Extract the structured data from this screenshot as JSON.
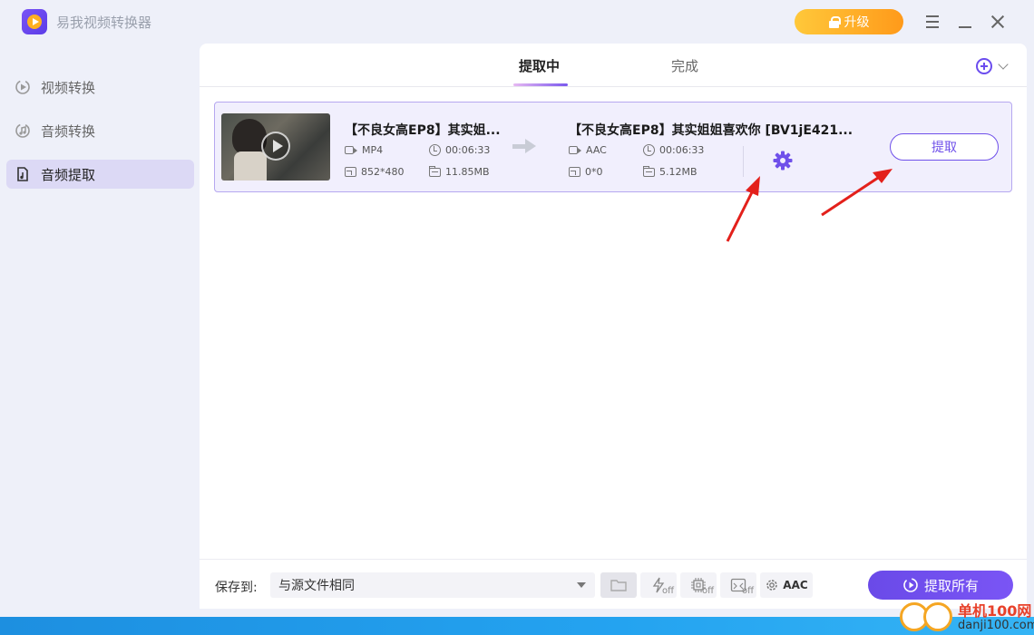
{
  "app": {
    "title": "易我视频转换器"
  },
  "titlebar": {
    "upgrade_label": "升级"
  },
  "sidebar": {
    "items": [
      {
        "label": "视频转换",
        "icon": "video-convert-icon",
        "active": false
      },
      {
        "label": "音频转换",
        "icon": "audio-convert-icon",
        "active": false
      },
      {
        "label": "音频提取",
        "icon": "audio-extract-icon",
        "active": true
      }
    ]
  },
  "tabs": [
    {
      "label": "提取中",
      "active": true
    },
    {
      "label": "完成",
      "active": false
    }
  ],
  "task": {
    "source": {
      "name": "【不良女高EP8】其实姐...",
      "format": "MP4",
      "duration": "00:06:33",
      "resolution": "852*480",
      "size": "11.85MB"
    },
    "output": {
      "name": "【不良女高EP8】其实姐姐喜欢你 [BV1jE421...",
      "format": "AAC",
      "duration": "00:06:33",
      "resolution": "0*0",
      "size": "5.12MB"
    },
    "extract_label": "提取"
  },
  "footer": {
    "save_label": "保存到:",
    "save_value": "与源文件相同",
    "off_label": "off",
    "audio_format": "AAC",
    "extract_all_label": "提取所有"
  },
  "watermark": {
    "line1": "单机100网",
    "line2": "danji100.com"
  },
  "colors": {
    "accent": "#6f50ea",
    "upgrade": "#ffb020",
    "annotation": "#e3201b"
  }
}
